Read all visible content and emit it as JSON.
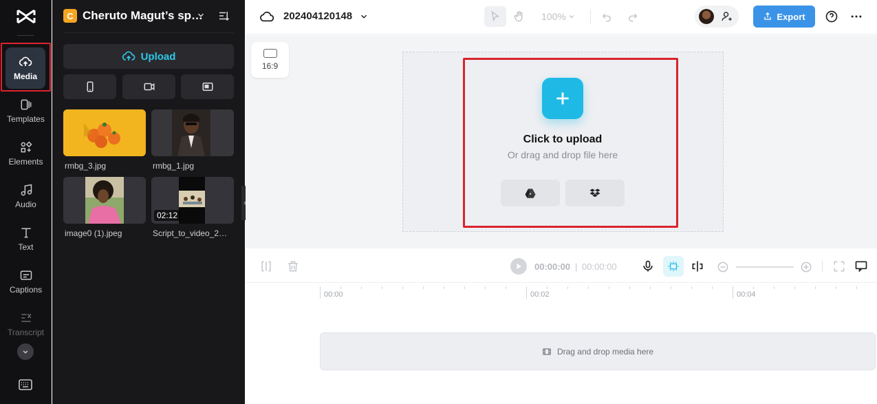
{
  "rail": {
    "items": [
      {
        "label": "Media"
      },
      {
        "label": "Templates"
      },
      {
        "label": "Elements"
      },
      {
        "label": "Audio"
      },
      {
        "label": "Text"
      },
      {
        "label": "Captions"
      },
      {
        "label": "Transcript"
      }
    ]
  },
  "panel": {
    "project_badge": "C",
    "project_name": "Cheruto Magut’s sp…",
    "upload_label": "Upload",
    "media": [
      {
        "name": "rmbg_3.jpg"
      },
      {
        "name": "rmbg_1.jpg"
      },
      {
        "name": "image0 (1).jpeg"
      },
      {
        "name": "Script_to_video_2…",
        "duration": "02:12"
      }
    ]
  },
  "topbar": {
    "doc_name": "202404120148",
    "zoom": "100%",
    "export_label": "Export"
  },
  "canvas": {
    "aspect_ratio": "16:9",
    "click_to_upload": "Click to upload",
    "drag_drop_hint": "Or drag and drop file here"
  },
  "timeline": {
    "current_time": "00:00:00",
    "separator": "|",
    "total_time": "00:00:00",
    "ruler": [
      "00:00",
      "00:02",
      "00:04"
    ],
    "track_hint": "Drag and drop media here"
  },
  "colors": {
    "accent": "#1fb9e6",
    "export": "#3b93e8",
    "highlight": "#d9232d",
    "rail_bg": "#111113",
    "panel_bg": "#18181b"
  }
}
